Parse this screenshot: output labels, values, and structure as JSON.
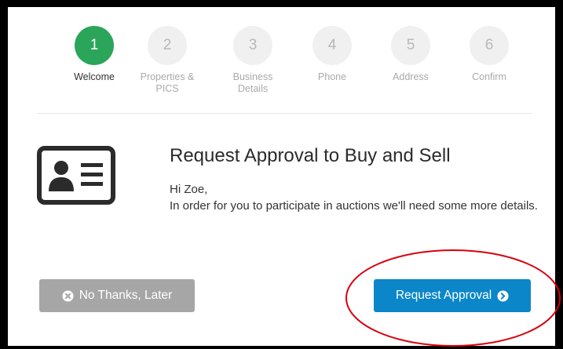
{
  "steps": [
    {
      "number": "1",
      "label": "Welcome",
      "active": true
    },
    {
      "number": "2",
      "label": "Properties & PICS",
      "active": false
    },
    {
      "number": "3",
      "label": "Business Details",
      "active": false
    },
    {
      "number": "4",
      "label": "Phone",
      "active": false
    },
    {
      "number": "5",
      "label": "Address",
      "active": false
    },
    {
      "number": "6",
      "label": "Confirm",
      "active": false
    }
  ],
  "content": {
    "title": "Request Approval to Buy and Sell",
    "greeting": "Hi Zoe,",
    "message": "In order for you to participate in auctions we'll need some more details."
  },
  "buttons": {
    "later_label": "No Thanks, Later",
    "approve_label": "Request Approval"
  },
  "icons": {
    "id_card": "id-card-icon",
    "later": "close-circle-icon",
    "approve": "chevron-right-circle-icon"
  },
  "colors": {
    "active_step": "#2aa55a",
    "inactive_step": "#f0f0f0",
    "primary_button": "#0b86c9",
    "secondary_button": "#a6a6a6",
    "annotation": "#d9000d"
  }
}
